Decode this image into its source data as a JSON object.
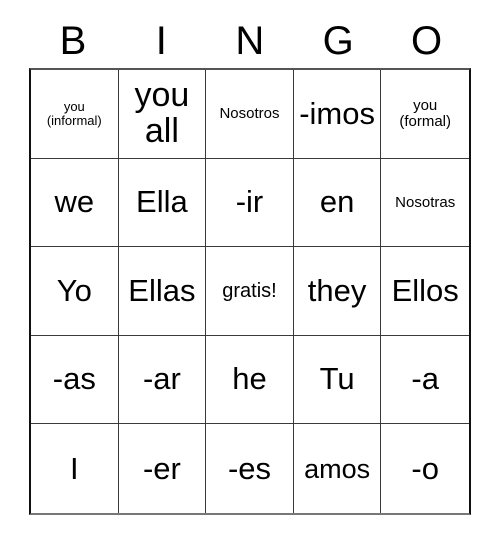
{
  "header": {
    "letters": [
      "B",
      "I",
      "N",
      "G",
      "O"
    ]
  },
  "grid": {
    "rows": [
      [
        {
          "text": "you\n(informal)",
          "size": "xxs"
        },
        {
          "text": "you all",
          "size": "xl"
        },
        {
          "text": "Nosotros",
          "size": "xs"
        },
        {
          "text": "-imos",
          "size": "lg"
        },
        {
          "text": "you\n(formal)",
          "size": "xs"
        }
      ],
      [
        {
          "text": "we",
          "size": "lg"
        },
        {
          "text": "Ella",
          "size": "lg"
        },
        {
          "text": "-ir",
          "size": "lg"
        },
        {
          "text": "en",
          "size": "lg"
        },
        {
          "text": "Nosotras",
          "size": "xs"
        }
      ],
      [
        {
          "text": "Yo",
          "size": "lg"
        },
        {
          "text": "Ellas",
          "size": "lg"
        },
        {
          "text": "gratis!",
          "size": "sm"
        },
        {
          "text": "they",
          "size": "lg"
        },
        {
          "text": "Ellos",
          "size": "lg"
        }
      ],
      [
        {
          "text": "-as",
          "size": "lg"
        },
        {
          "text": "-ar",
          "size": "lg"
        },
        {
          "text": "he",
          "size": "lg"
        },
        {
          "text": "Tu",
          "size": "lg"
        },
        {
          "text": "-a",
          "size": "lg"
        }
      ],
      [
        {
          "text": "I",
          "size": "lg"
        },
        {
          "text": "-er",
          "size": "lg"
        },
        {
          "text": "-es",
          "size": "lg"
        },
        {
          "text": "amos",
          "size": "md"
        },
        {
          "text": "-o",
          "size": "lg"
        }
      ]
    ]
  }
}
